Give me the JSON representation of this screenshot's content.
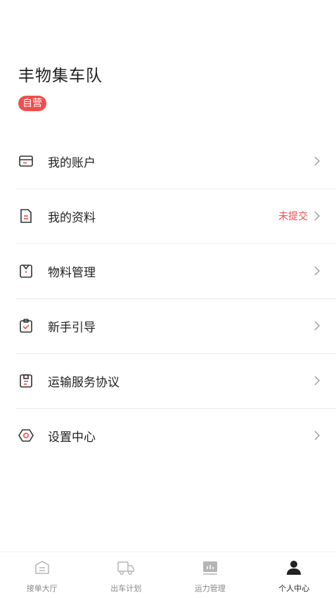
{
  "profile": {
    "team_name": "丰物集车队",
    "badge": "自营",
    "badge_color": "#f04e4e"
  },
  "menu": [
    {
      "label": "我的账户",
      "icon": "wallet-card-icon",
      "status": ""
    },
    {
      "label": "我的资料",
      "icon": "document-icon",
      "status": "未提交",
      "status_color": "#f04e4e"
    },
    {
      "label": "物料管理",
      "icon": "clothing-icon",
      "status": ""
    },
    {
      "label": "新手引导",
      "icon": "checklist-icon",
      "status": ""
    },
    {
      "label": "运输服务协议",
      "icon": "agreement-icon",
      "status": ""
    },
    {
      "label": "设置中心",
      "icon": "settings-hexagon-icon",
      "status": ""
    }
  ],
  "tabbar": [
    {
      "label": "接单大厅",
      "icon": "order-hall-icon",
      "active": false
    },
    {
      "label": "出车计划",
      "icon": "truck-icon",
      "active": false
    },
    {
      "label": "运力管理",
      "icon": "capacity-chart-icon",
      "active": false
    },
    {
      "label": "个人中心",
      "icon": "user-icon",
      "active": true
    }
  ],
  "colors": {
    "accent_red": "#f04e4e",
    "icon_dark": "#333333",
    "tab_inactive": "#b5b5b5",
    "tab_active": "#222222"
  }
}
